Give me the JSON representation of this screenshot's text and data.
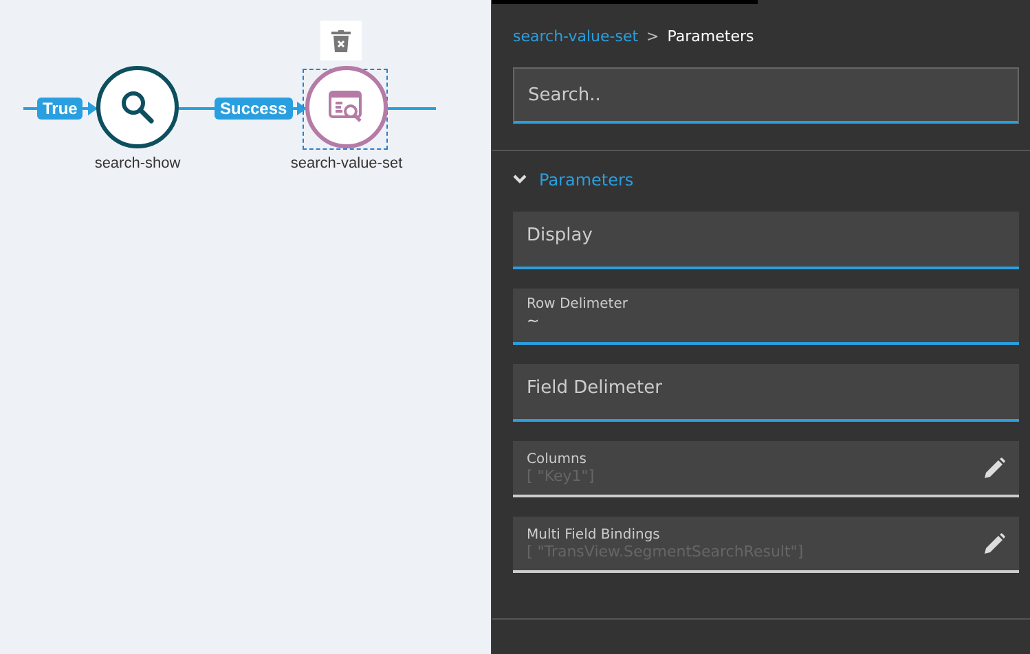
{
  "flow": {
    "edges": [
      {
        "label": "True"
      },
      {
        "label": "Success"
      }
    ],
    "nodes": [
      {
        "label": "search-show",
        "kind": "search",
        "color": "#0d4f5f",
        "selected": false
      },
      {
        "label": "search-value-set",
        "kind": "value-set",
        "color": "#b57ba6",
        "selected": true
      }
    ]
  },
  "panel": {
    "breadcrumb": {
      "parent": "search-value-set",
      "separator": ">",
      "current": "Parameters"
    },
    "search": {
      "placeholder": "Search.."
    },
    "section": {
      "title": "Parameters",
      "expanded": true
    },
    "fields": [
      {
        "kind": "empty",
        "label": "Display"
      },
      {
        "kind": "text",
        "label": "Row Delimeter",
        "value": "~"
      },
      {
        "kind": "empty",
        "label": "Field Delimeter"
      },
      {
        "kind": "array",
        "label": "Columns",
        "value": "[  \"Key1\"]"
      },
      {
        "kind": "array",
        "label": "Multi Field Bindings",
        "value": "[  \"TransView.SegmentSearchResult\"]"
      }
    ]
  }
}
